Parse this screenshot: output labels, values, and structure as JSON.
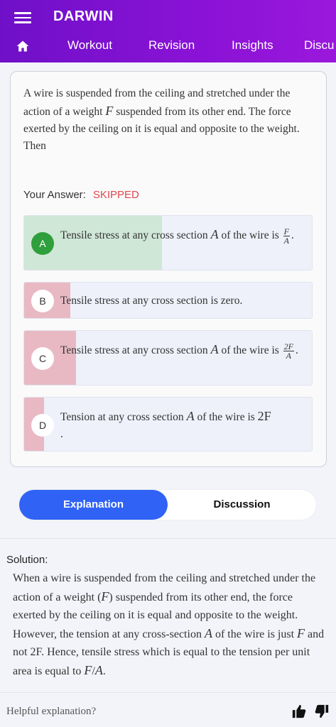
{
  "header": {
    "title": "DARWIN",
    "tabs": [
      "Workout",
      "Revision",
      "Insights",
      "Discu"
    ]
  },
  "question": {
    "text_1": "A wire is suspended from the ceiling and stretched under the action of a weight ",
    "var_F": "F",
    "text_2": " suspended from its other end. The force exerted by the ceiling on it is equal and opposite to the weight. Then"
  },
  "your_answer": {
    "label": "Your Answer:",
    "value": "SKIPPED"
  },
  "options": [
    {
      "letter": "A",
      "text": "Tensile stress at any cross section ",
      "var": "A",
      "text2": " of the wire is ",
      "num": "F",
      "den": "A",
      "end": ".",
      "fill_percent": 48,
      "fill_color": "#cfe7d6",
      "correct": true
    },
    {
      "letter": "B",
      "text": "Tensile stress at any cross section is zero.",
      "fill_percent": 16,
      "fill_color": "#e9b9c3",
      "correct": false
    },
    {
      "letter": "C",
      "text": "Tensile stress at any cross section ",
      "var": "A",
      "text2": " of the wire is ",
      "num": "2F",
      "den": "A",
      "end": ".",
      "fill_percent": 18,
      "fill_color": "#e9b9c3",
      "correct": false
    },
    {
      "letter": "D",
      "text": "Tension at any cross section ",
      "var": "A",
      "text2": " of the wire is ",
      "strong": "2F",
      "end": ".",
      "fill_percent": 7,
      "fill_color": "#e9b9c3",
      "correct": false
    }
  ],
  "tabs": {
    "explanation": "Explanation",
    "discussion": "Discussion"
  },
  "solution": {
    "title": "Solution:",
    "p1": "When a wire is suspended from the ceiling and stretched under the action of a weight (",
    "F1": "F",
    "p2": ") suspended from its other end, the force exerted by the ceiling on it is equal and opposite to the weight. However, the tension at any cross-section ",
    "A1": "A",
    "p3": " of the wire is just ",
    "F2": "F",
    "p4": " and not 2F. Hence, tensile stress which is equal to the tension per unit area is equal to ",
    "F3": "F",
    "slash": "/",
    "A2": "A",
    "p5": "."
  },
  "footer": {
    "helpful": "Helpful explanation?"
  },
  "icons": [
    "menu-icon",
    "home-icon",
    "thumbs-up-icon",
    "thumbs-down-icon"
  ]
}
